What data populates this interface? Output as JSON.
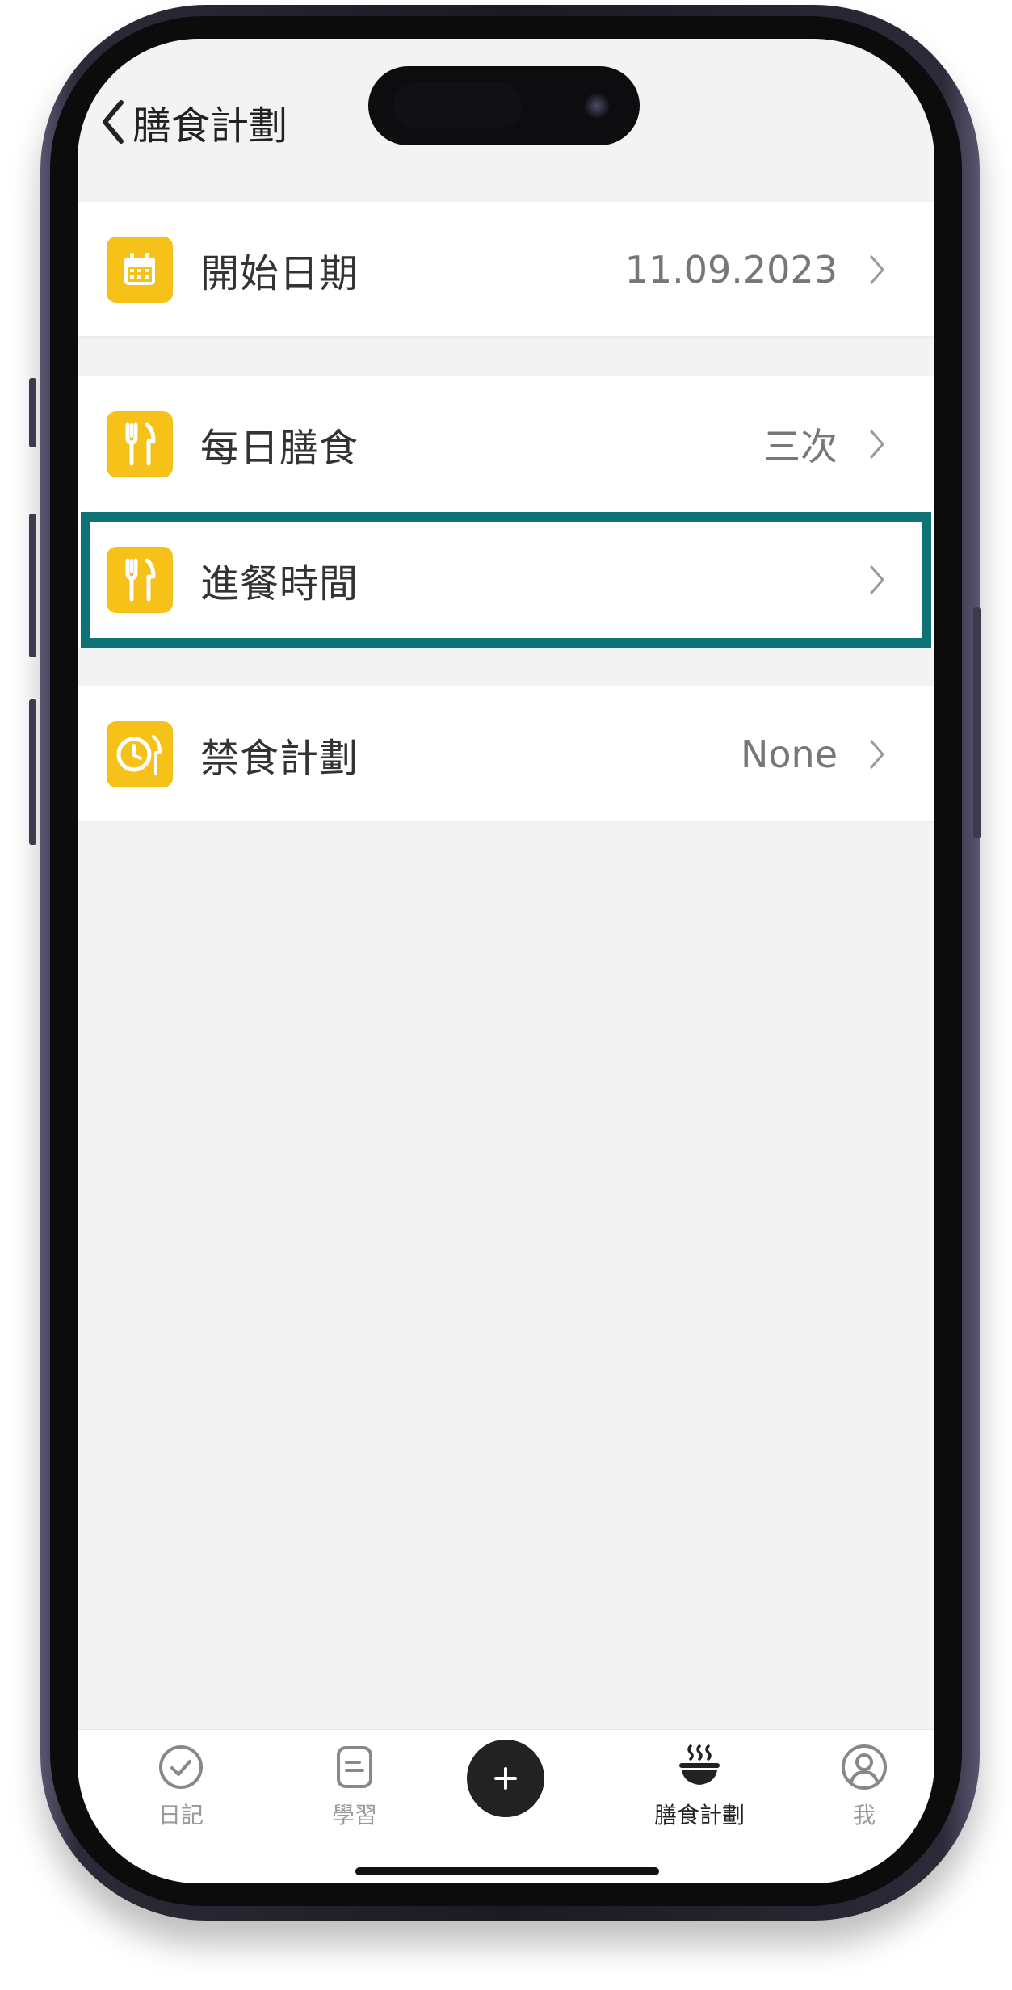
{
  "header": {
    "title": "膳食計劃"
  },
  "settings": {
    "start_date": {
      "label": "開始日期",
      "value": "11.09.2023",
      "icon": "calendar-icon"
    },
    "daily_meals": {
      "label": "每日膳食",
      "value": "三次",
      "icon": "utensils-icon"
    },
    "meal_times": {
      "label": "進餐時間",
      "value": "",
      "icon": "utensils-icon"
    },
    "fasting_plan": {
      "label": "禁食計劃",
      "value": "None",
      "icon": "fasting-clock-icon"
    }
  },
  "tabbar": {
    "items": [
      {
        "label": "日記",
        "icon": "check-circle-icon",
        "active": false
      },
      {
        "label": "學習",
        "icon": "notes-icon",
        "active": false
      },
      {
        "label": "",
        "icon": "plus-icon",
        "active": false
      },
      {
        "label": "膳食計劃",
        "icon": "steaming-bowl-icon",
        "active": true
      },
      {
        "label": "我",
        "icon": "profile-icon",
        "active": false
      }
    ]
  },
  "colors": {
    "accent_icon_bg": "#f6c21a",
    "highlight_border": "#0f7275",
    "background": "#f3f3f4"
  }
}
